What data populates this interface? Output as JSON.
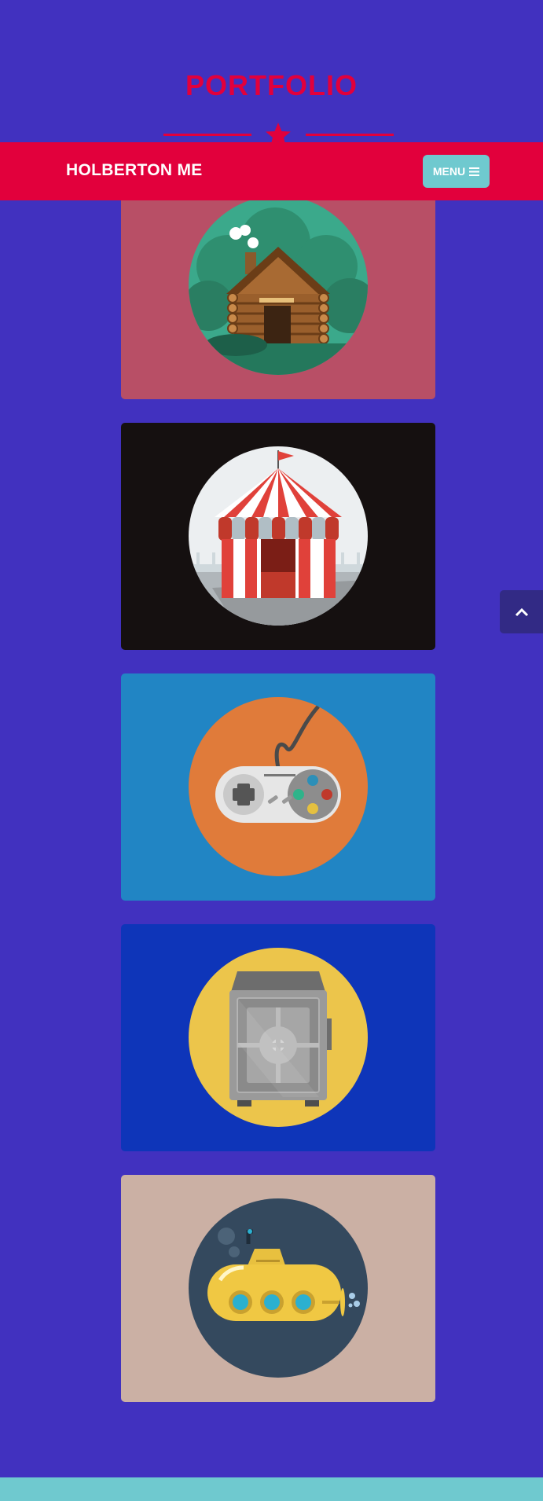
{
  "page": {
    "heading": "PORTFOLIO",
    "background_color": "#4131bf",
    "accent_color": "#e2003c"
  },
  "navbar": {
    "brand": "HOLBERTON ME",
    "menu_label": "MENU",
    "menu_icon": "bars-icon"
  },
  "portfolio": {
    "items": [
      {
        "name": "cabin",
        "background": "#b84f66"
      },
      {
        "name": "circus",
        "background": "#151010"
      },
      {
        "name": "game",
        "background": "#2185c4"
      },
      {
        "name": "safe",
        "background": "#0e35b9"
      },
      {
        "name": "submarine",
        "background": "#cbb0a4"
      }
    ]
  },
  "scroll_top": {
    "icon": "chevron-up-icon"
  },
  "footer": {
    "color": "#6fc9cf"
  }
}
